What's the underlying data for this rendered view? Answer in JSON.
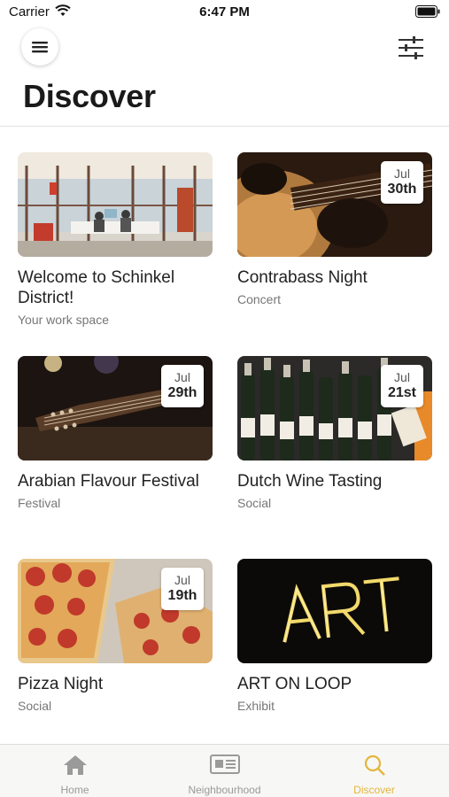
{
  "status_bar": {
    "carrier": "Carrier",
    "time": "6:47 PM"
  },
  "header": {
    "title": "Discover",
    "menu_icon": "hamburger-icon",
    "filter_icon": "sliders-icon"
  },
  "cards": [
    {
      "title": "Welcome to Schinkel District!",
      "subtitle": "Your work space",
      "month": "",
      "day": "",
      "image": "office-interior"
    },
    {
      "title": "Contrabass Night",
      "subtitle": "Concert",
      "month": "Jul",
      "day": "30th",
      "image": "guitar-player"
    },
    {
      "title": "Arabian Flavour Festival",
      "subtitle": "Festival",
      "month": "Jul",
      "day": "29th",
      "image": "guitar-dark"
    },
    {
      "title": "Dutch Wine Tasting",
      "subtitle": "Social",
      "month": "Jul",
      "day": "21st",
      "image": "wine-bottles"
    },
    {
      "title": "Pizza Night",
      "subtitle": "Social",
      "month": "Jul",
      "day": "19th",
      "image": "pizza"
    },
    {
      "title": "ART ON LOOP",
      "subtitle": "Exhibit",
      "month": "",
      "day": "",
      "image": "art-neon-sign"
    }
  ],
  "tab_bar": {
    "tabs": [
      {
        "label": "Home",
        "icon": "home-icon"
      },
      {
        "label": "Neighbourhood",
        "icon": "newspaper-icon"
      },
      {
        "label": "Discover",
        "icon": "search-icon"
      }
    ],
    "active_color": "#e3b53c",
    "inactive_color": "#9a9a9a"
  }
}
